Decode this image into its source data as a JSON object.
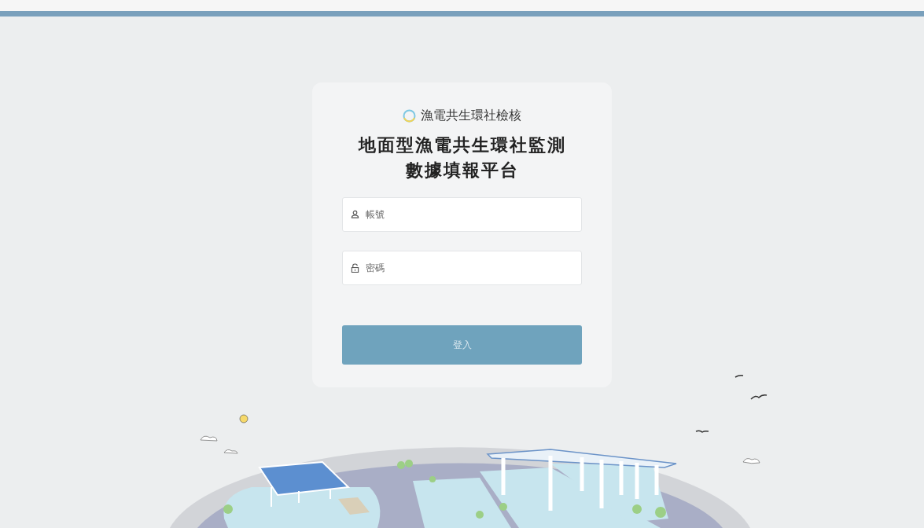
{
  "brand": {
    "name": "漁電共生環社檢核"
  },
  "title_lines": [
    "地面型漁電共生環社監測",
    "數據填報平台"
  ],
  "fields": [
    {
      "kind": "user",
      "placeholder": "帳號"
    },
    {
      "kind": "password",
      "placeholder": "密碼"
    }
  ],
  "login_button": {
    "label": "登入"
  }
}
